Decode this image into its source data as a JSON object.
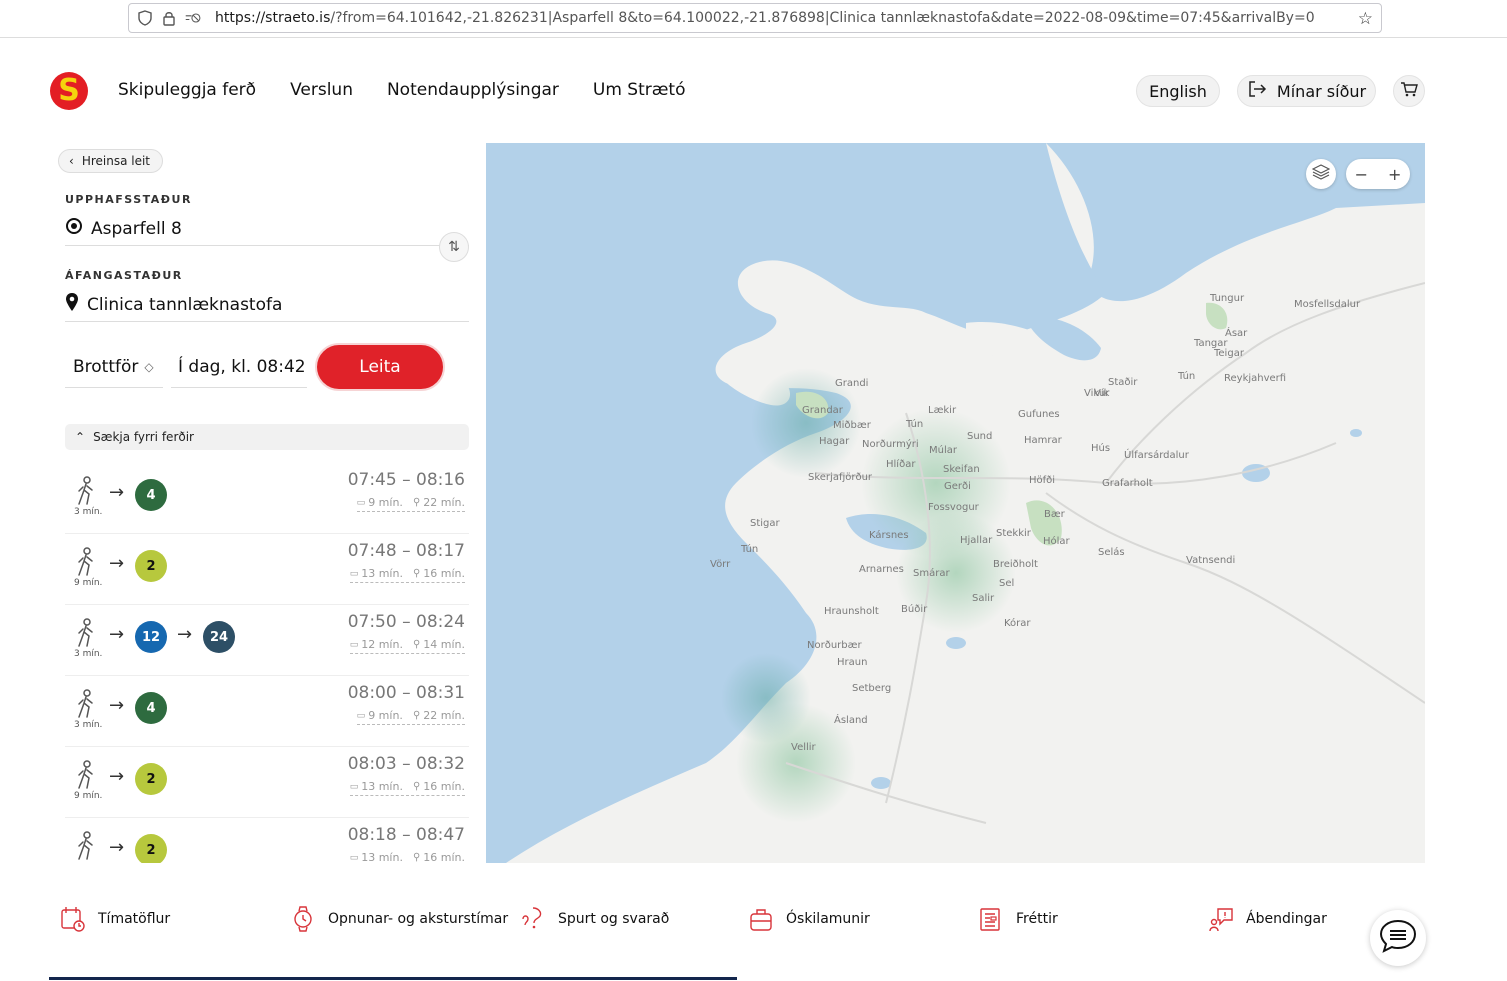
{
  "browser": {
    "url_host": "https://straeto.is",
    "url_rest": "/?from=64.101642,-21.826231|Asparfell 8&to=64.100022,-21.876898|Clinica tannlæknastofa&date=2022-08-09&time=07:45&arrivalBy=0",
    "icons": [
      "shield-icon",
      "lock-icon",
      "tracking-icon",
      "star-icon"
    ]
  },
  "header": {
    "logo_letter": "S",
    "nav": [
      "Skipuleggja ferð",
      "Verslun",
      "Notendaupplýsingar",
      "Um Strætó"
    ],
    "language_label": "English",
    "my_pages_label": "Mínar síður"
  },
  "planner": {
    "clear_label": "Hreinsa leit",
    "origin_label": "UPPHAFSSTAÐUR",
    "origin_value": "Asparfell 8",
    "destination_label": "ÁFANGASTAÐUR",
    "destination_value": "Clinica tannlæknastofa",
    "mode_label": "Brottför",
    "time_value": "Í dag, kl. 08:42",
    "search_label": "Leita",
    "previous_label": "Sækja fyrri ferðir"
  },
  "trips": [
    {
      "walk": "3 mín.",
      "legs": [
        {
          "route": "4",
          "color": "#2e6b3f",
          "light": false
        }
      ],
      "depart": "07:45",
      "arrive": "08:16",
      "bus_min": "9 mín.",
      "walk_min": "22 mín."
    },
    {
      "walk": "9 mín.",
      "legs": [
        {
          "route": "2",
          "color": "#b7c83d",
          "light": true
        }
      ],
      "depart": "07:48",
      "arrive": "08:17",
      "bus_min": "13 mín.",
      "walk_min": "16 mín."
    },
    {
      "walk": "3 mín.",
      "legs": [
        {
          "route": "12",
          "color": "#1668b0",
          "light": false
        },
        {
          "route": "24",
          "color": "#2d4f66",
          "light": false
        }
      ],
      "depart": "07:50",
      "arrive": "08:24",
      "bus_min": "12 mín.",
      "walk_min": "14 mín."
    },
    {
      "walk": "3 mín.",
      "legs": [
        {
          "route": "4",
          "color": "#2e6b3f",
          "light": false
        }
      ],
      "depart": "08:00",
      "arrive": "08:31",
      "bus_min": "9 mín.",
      "walk_min": "22 mín."
    },
    {
      "walk": "9 mín.",
      "legs": [
        {
          "route": "2",
          "color": "#b7c83d",
          "light": true
        }
      ],
      "depart": "08:03",
      "arrive": "08:32",
      "bus_min": "13 mín.",
      "walk_min": "16 mín."
    },
    {
      "walk": "",
      "legs": [
        {
          "route": "2",
          "color": "#b7c83d",
          "light": true
        }
      ],
      "depart": "08:18",
      "arrive": "08:47",
      "bus_min": "13 mín.",
      "walk_min": "16 mín."
    }
  ],
  "map": {
    "water_color": "#b3d1e9",
    "land_color": "#f2f2f0",
    "labels": [
      {
        "text": "Tungur"
      },
      {
        "text": "Mosfellsdalur"
      },
      {
        "text": "Ásar"
      },
      {
        "text": "Tangar"
      },
      {
        "text": "Teigar"
      },
      {
        "text": "Reykjahverfi"
      },
      {
        "text": "Grandi"
      },
      {
        "text": "Staðir"
      },
      {
        "text": "Tún"
      },
      {
        "text": "Vík"
      },
      {
        "text": "Vikur"
      },
      {
        "text": "Grandar"
      },
      {
        "text": "Lækir"
      },
      {
        "text": "Gufunes"
      },
      {
        "text": "Miðbær"
      },
      {
        "text": "Hagar"
      },
      {
        "text": "Norðurmýri"
      },
      {
        "text": "Tún"
      },
      {
        "text": "Sund"
      },
      {
        "text": "Hamrar"
      },
      {
        "text": "Hús"
      },
      {
        "text": "Úlfarsárdalur"
      },
      {
        "text": "Múlar"
      },
      {
        "text": "Hlíðar"
      },
      {
        "text": "Skeifan"
      },
      {
        "text": "Skerjafjörður"
      },
      {
        "text": "Gerði"
      },
      {
        "text": "Höfði"
      },
      {
        "text": "Grafarholt"
      },
      {
        "text": "Fossvogur"
      },
      {
        "text": "Bær"
      },
      {
        "text": "Stigar"
      },
      {
        "text": "Kársnes"
      },
      {
        "text": "Stekkir"
      },
      {
        "text": "Hólar"
      },
      {
        "text": "Tún"
      },
      {
        "text": "Hjallar"
      },
      {
        "text": "Selás"
      },
      {
        "text": "Vatnsendi"
      },
      {
        "text": "Breiðholt"
      },
      {
        "text": "Vörr"
      },
      {
        "text": "Arnarnes"
      },
      {
        "text": "Smárar"
      },
      {
        "text": "Sel"
      },
      {
        "text": "Salir"
      },
      {
        "text": "Hraunsholt"
      },
      {
        "text": "Búðir"
      },
      {
        "text": "Kórar"
      },
      {
        "text": "Norðurbær"
      },
      {
        "text": "Hraun"
      },
      {
        "text": "Setberg"
      },
      {
        "text": "Ásland"
      },
      {
        "text": "Vellir"
      }
    ]
  },
  "footer": [
    {
      "label": "Tímatöflur",
      "icon": "calendar-clock-icon"
    },
    {
      "label": "Opnunar- og aksturstímar",
      "icon": "watch-icon"
    },
    {
      "label": "Spurt og svarað",
      "icon": "question-icon"
    },
    {
      "label": "Óskilamunir",
      "icon": "bag-icon"
    },
    {
      "label": "Fréttir",
      "icon": "news-icon"
    },
    {
      "label": "Ábendingar",
      "icon": "feedback-icon"
    }
  ]
}
